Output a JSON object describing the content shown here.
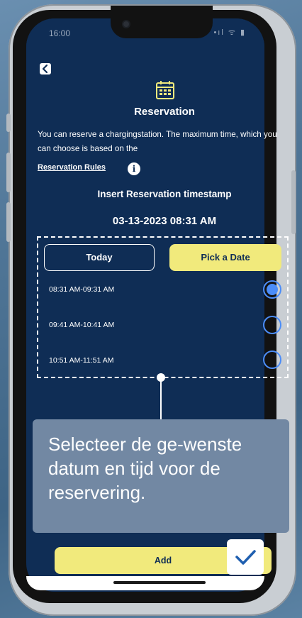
{
  "status_bar": {
    "time": "16:00",
    "icons": "•ıl ᯤ ▮"
  },
  "header": {
    "back_icon": "chevron-left-icon",
    "calendar_icon": "calendar-icon",
    "title": "Reservation"
  },
  "description": "You can reserve a chargingstation. The maximum time, which you can choose is based on the",
  "rules_link": "Reservation Rules",
  "info_icon": "i",
  "insert_label": "Insert Reservation timestamp",
  "selected_datetime": "03-13-2023 08:31 AM",
  "date_buttons": {
    "today": "Today",
    "pick": "Pick a Date"
  },
  "time_slots": [
    {
      "label": "08:31 AM-09:31 AM",
      "selected": true
    },
    {
      "label": "09:41 AM-10:41 AM",
      "selected": false
    },
    {
      "label": "10:51 AM-11:51 AM",
      "selected": false
    }
  ],
  "tooltip": {
    "text": "Selecteer de ge-wenste datum en tijd voor de reservering."
  },
  "add_button": "Add",
  "colors": {
    "screen_bg": "#0f2d55",
    "accent_yellow": "#f1ea7c",
    "radio_blue": "#4b8df8",
    "tooltip_bg": "#7288a3"
  }
}
